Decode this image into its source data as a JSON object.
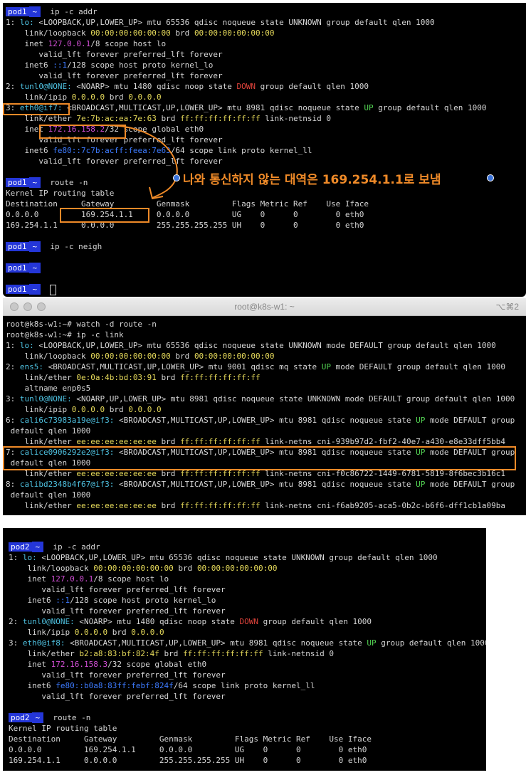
{
  "term1": {
    "lines": [
      [
        {
          "prompt": "pod1"
        },
        {
          "t": "ip -c addr"
        }
      ],
      [
        {
          "t": "1: "
        },
        {
          "t": "lo:",
          "c": "cyan"
        },
        {
          "t": " <LOOPBACK,UP,LOWER_UP> mtu 65536 qdisc noqueue state UNKNOWN group default qlen 1000"
        }
      ],
      [
        {
          "t": "    link/loopback "
        },
        {
          "t": "00:00:00:00:00:00",
          "c": "yellow"
        },
        {
          "t": " brd "
        },
        {
          "t": "00:00:00:00:00:00",
          "c": "yellow"
        }
      ],
      [
        {
          "t": "    inet "
        },
        {
          "t": "127.0.0.1",
          "c": "mag"
        },
        {
          "t": "/8 scope host lo"
        }
      ],
      [
        {
          "t": "       valid_lft forever preferred_lft forever"
        }
      ],
      [
        {
          "t": "    inet6 "
        },
        {
          "t": "::1",
          "c": "blue"
        },
        {
          "t": "/128 scope host proto kernel_lo"
        }
      ],
      [
        {
          "t": "       valid_lft forever preferred_lft forever"
        }
      ],
      [
        {
          "t": "2: "
        },
        {
          "t": "tunl0@NONE:",
          "c": "cyan"
        },
        {
          "t": " <NOARP> mtu 1480 qdisc noop state "
        },
        {
          "t": "DOWN",
          "c": "red"
        },
        {
          "t": " group default qlen 1000"
        }
      ],
      [
        {
          "t": "    link/ipip "
        },
        {
          "t": "0.0.0.0",
          "c": "yellow"
        },
        {
          "t": " brd "
        },
        {
          "t": "0.0.0.0",
          "c": "yellow"
        }
      ],
      [
        {
          "t": "3: "
        },
        {
          "t": "eth0@if7:",
          "c": "cyan"
        },
        {
          "t": " <BROADCAST,MULTICAST,UP,LOWER_UP> mtu 8981 qdisc noqueue state "
        },
        {
          "t": "UP",
          "c": "green"
        },
        {
          "t": " group default qlen 1000"
        }
      ],
      [
        {
          "t": "    link/ether "
        },
        {
          "t": "7e:7b:ac:ea:7e:63",
          "c": "yellow"
        },
        {
          "t": " brd "
        },
        {
          "t": "ff:ff:ff:ff:ff:ff",
          "c": "yellow"
        },
        {
          "t": " link-netnsid 0"
        }
      ],
      [
        {
          "t": "    inet "
        },
        {
          "t": "172.16.158.2",
          "c": "mag"
        },
        {
          "t": "/32 scope global eth0"
        }
      ],
      [
        {
          "t": "       valid_lft forever preferred_lft forever"
        }
      ],
      [
        {
          "t": "    inet6 "
        },
        {
          "t": "fe80::7c7b:acff:feea:7e63",
          "c": "blue"
        },
        {
          "t": "/64 scope link proto kernel_ll"
        }
      ],
      [
        {
          "t": "       valid_lft forever preferred_lft forever"
        }
      ],
      [
        {
          "t": ""
        }
      ],
      [
        {
          "prompt": "pod1"
        },
        {
          "t": "route -n"
        }
      ],
      [
        {
          "t": "Kernel IP routing table"
        }
      ],
      [
        {
          "t": "Destination     Gateway         Genmask         Flags Metric Ref    Use Iface"
        }
      ],
      [
        {
          "t": "0.0.0.0         169.254.1.1     0.0.0.0         UG    0      0        0 eth0"
        }
      ],
      [
        {
          "t": "169.254.1.1     0.0.0.0         255.255.255.255 UH    0      0        0 eth0"
        }
      ],
      [
        {
          "t": ""
        }
      ],
      [
        {
          "prompt": "pod1"
        },
        {
          "t": "ip -c neigh"
        }
      ],
      [
        {
          "t": ""
        }
      ],
      [
        {
          "prompt": "pod1"
        },
        {
          "t": ""
        }
      ],
      [
        {
          "t": ""
        }
      ],
      [
        {
          "prompt": "pod1"
        },
        {
          "cursor": true
        }
      ]
    ]
  },
  "term2": {
    "title": "root@k8s-w1: ~",
    "shortcut": "⌥⌘2",
    "lines": [
      [
        {
          "t": "root@k8s-w1:~# watch -d route -n"
        }
      ],
      [
        {
          "t": "root@k8s-w1:~# ip -c link"
        }
      ],
      [
        {
          "t": "1: "
        },
        {
          "t": "lo:",
          "c": "cyan"
        },
        {
          "t": " <LOOPBACK,UP,LOWER_UP> mtu 65536 qdisc noqueue state UNKNOWN mode DEFAULT group default qlen 1000"
        }
      ],
      [
        {
          "t": "    link/loopback "
        },
        {
          "t": "00:00:00:00:00:00",
          "c": "yellow"
        },
        {
          "t": " brd "
        },
        {
          "t": "00:00:00:00:00:00",
          "c": "yellow"
        }
      ],
      [
        {
          "t": "2: "
        },
        {
          "t": "ens5:",
          "c": "cyan"
        },
        {
          "t": " <BROADCAST,MULTICAST,UP,LOWER_UP> mtu 9001 qdisc mq state "
        },
        {
          "t": "UP",
          "c": "green"
        },
        {
          "t": " mode DEFAULT group default qlen 1000"
        }
      ],
      [
        {
          "t": "    link/ether "
        },
        {
          "t": "0e:0a:4b:bd:03:91",
          "c": "yellow"
        },
        {
          "t": " brd "
        },
        {
          "t": "ff:ff:ff:ff:ff:ff",
          "c": "yellow"
        }
      ],
      [
        {
          "t": "    altname enp0s5"
        }
      ],
      [
        {
          "t": "3: "
        },
        {
          "t": "tunl0@NONE:",
          "c": "cyan"
        },
        {
          "t": " <NOARP,UP,LOWER_UP> mtu 8981 qdisc noqueue state UNKNOWN mode DEFAULT group default qlen 1000"
        }
      ],
      [
        {
          "t": "    link/ipip "
        },
        {
          "t": "0.0.0.0",
          "c": "yellow"
        },
        {
          "t": " brd "
        },
        {
          "t": "0.0.0.0",
          "c": "yellow"
        }
      ],
      [
        {
          "t": "6: "
        },
        {
          "t": "cali6c73983a19e@if3:",
          "c": "cyan"
        },
        {
          "t": " <BROADCAST,MULTICAST,UP,LOWER_UP> mtu 8981 qdisc noqueue state "
        },
        {
          "t": "UP",
          "c": "green"
        },
        {
          "t": " mode DEFAULT group"
        }
      ],
      [
        {
          "t": " default qlen 1000"
        }
      ],
      [
        {
          "t": "    link/ether "
        },
        {
          "t": "ee:ee:ee:ee:ee:ee",
          "c": "yellow"
        },
        {
          "t": " brd "
        },
        {
          "t": "ff:ff:ff:ff:ff:ff",
          "c": "yellow"
        },
        {
          "t": " link-netns cni-939b97d2-fbf2-40e7-a430-e8e33dff5bb4"
        }
      ],
      [
        {
          "t": "7: "
        },
        {
          "t": "calice0906292e2@if3:",
          "c": "cyan"
        },
        {
          "t": " <BROADCAST,MULTICAST,UP,LOWER_UP> mtu 8981 qdisc noqueue state "
        },
        {
          "t": "UP",
          "c": "green"
        },
        {
          "t": " mode DEFAULT group"
        }
      ],
      [
        {
          "t": " default qlen 1000"
        }
      ],
      [
        {
          "t": "    link/ether "
        },
        {
          "t": "ee:ee:ee:ee:ee:ee",
          "c": "yellow"
        },
        {
          "t": " brd "
        },
        {
          "t": "ff:ff:ff:ff:ff:ff",
          "c": "yellow"
        },
        {
          "t": " link-netns cni-f0c86722-1449-6781-5819-8f6bec3b16c1"
        }
      ],
      [
        {
          "t": "8: "
        },
        {
          "t": "calibd2348b4f67@if3:",
          "c": "cyan"
        },
        {
          "t": " <BROADCAST,MULTICAST,UP,LOWER_UP> mtu 8981 qdisc noqueue state "
        },
        {
          "t": "UP",
          "c": "green"
        },
        {
          "t": " mode DEFAULT group"
        }
      ],
      [
        {
          "t": " default qlen 1000"
        }
      ],
      [
        {
          "t": "    link/ether "
        },
        {
          "t": "ee:ee:ee:ee:ee:ee",
          "c": "yellow"
        },
        {
          "t": " brd "
        },
        {
          "t": "ff:ff:ff:ff:ff:ff",
          "c": "yellow"
        },
        {
          "t": " link-netns cni-f6ab9205-aca5-0b2c-b6f6-dff1cb1a09ba"
        }
      ]
    ]
  },
  "term3": {
    "lines": [
      [
        {
          "prompt": "pod2"
        },
        {
          "t": "ip -c addr"
        }
      ],
      [
        {
          "t": "1: "
        },
        {
          "t": "lo:",
          "c": "cyan"
        },
        {
          "t": " <LOOPBACK,UP,LOWER_UP> mtu 65536 qdisc noqueue state UNKNOWN group default qlen 1000"
        }
      ],
      [
        {
          "t": "    link/loopback "
        },
        {
          "t": "00:00:00:00:00:00",
          "c": "yellow"
        },
        {
          "t": " brd "
        },
        {
          "t": "00:00:00:00:00:00",
          "c": "yellow"
        }
      ],
      [
        {
          "t": "    inet "
        },
        {
          "t": "127.0.0.1",
          "c": "mag"
        },
        {
          "t": "/8 scope host lo"
        }
      ],
      [
        {
          "t": "       valid_lft forever preferred_lft forever"
        }
      ],
      [
        {
          "t": "    inet6 "
        },
        {
          "t": "::1",
          "c": "blue"
        },
        {
          "t": "/128 scope host proto kernel_lo"
        }
      ],
      [
        {
          "t": "       valid_lft forever preferred_lft forever"
        }
      ],
      [
        {
          "t": "2: "
        },
        {
          "t": "tunl0@NONE:",
          "c": "cyan"
        },
        {
          "t": " <NOARP> mtu 1480 qdisc noop state "
        },
        {
          "t": "DOWN",
          "c": "red"
        },
        {
          "t": " group default qlen 1000"
        }
      ],
      [
        {
          "t": "    link/ipip "
        },
        {
          "t": "0.0.0.0",
          "c": "yellow"
        },
        {
          "t": " brd "
        },
        {
          "t": "0.0.0.0",
          "c": "yellow"
        }
      ],
      [
        {
          "t": "3: "
        },
        {
          "t": "eth0@if8:",
          "c": "cyan"
        },
        {
          "t": " <BROADCAST,MULTICAST,UP,LOWER_UP> mtu 8981 qdisc noqueue state "
        },
        {
          "t": "UP",
          "c": "green"
        },
        {
          "t": " group default qlen 1000"
        }
      ],
      [
        {
          "t": "    link/ether "
        },
        {
          "t": "b2:a8:83:bf:82:4f",
          "c": "yellow"
        },
        {
          "t": " brd "
        },
        {
          "t": "ff:ff:ff:ff:ff:ff",
          "c": "yellow"
        },
        {
          "t": " link-netnsid 0"
        }
      ],
      [
        {
          "t": "    inet "
        },
        {
          "t": "172.16.158.3",
          "c": "mag"
        },
        {
          "t": "/32 scope global eth0"
        }
      ],
      [
        {
          "t": "       valid_lft forever preferred_lft forever"
        }
      ],
      [
        {
          "t": "    inet6 "
        },
        {
          "t": "fe80::b0a8:83ff:febf:824f",
          "c": "blue"
        },
        {
          "t": "/64 scope link proto kernel_ll"
        }
      ],
      [
        {
          "t": "       valid_lft forever preferred_lft forever"
        }
      ],
      [
        {
          "t": ""
        }
      ],
      [
        {
          "prompt": "pod2"
        },
        {
          "t": "route -n"
        }
      ],
      [
        {
          "t": "Kernel IP routing table"
        }
      ],
      [
        {
          "t": "Destination     Gateway         Genmask         Flags Metric Ref    Use Iface"
        }
      ],
      [
        {
          "t": "0.0.0.0         169.254.1.1     0.0.0.0         UG    0      0        0 eth0"
        }
      ],
      [
        {
          "t": "169.254.1.1     0.0.0.0         255.255.255.255 UH    0      0        0 eth0"
        }
      ]
    ]
  },
  "annotation": {
    "text": "나와 통신하지 않는 대역은 169.254.1.1로 보냄"
  },
  "colors": {
    "accent": "#ef8a28",
    "prompt_bg": "#2436d8",
    "terminal_bg": "#000000"
  }
}
